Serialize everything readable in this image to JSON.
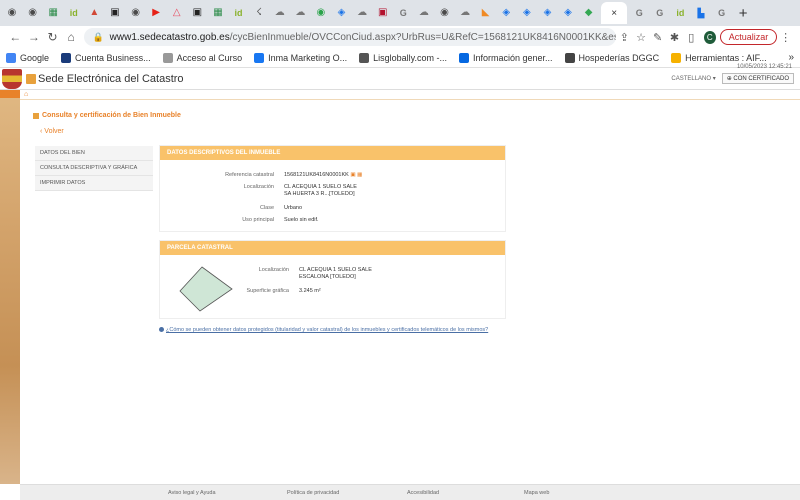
{
  "browser": {
    "tabs": [
      {
        "label": "",
        "color": "#4a4a4a",
        "glyph": "◉"
      },
      {
        "label": "",
        "color": "#4a4a4a",
        "glyph": "◉"
      },
      {
        "label": "",
        "color": "#2d8c4a",
        "glyph": "▦"
      },
      {
        "label": "id",
        "color": "#8ab22d",
        "glyph": ""
      },
      {
        "label": "",
        "color": "#d14836",
        "glyph": "▲"
      },
      {
        "label": "",
        "color": "#222222",
        "glyph": "▣"
      },
      {
        "label": "",
        "color": "#4a4a4a",
        "glyph": "◉"
      },
      {
        "label": "",
        "color": "#e62117",
        "glyph": "▶"
      },
      {
        "label": "",
        "color": "#e84a5f",
        "glyph": "△"
      },
      {
        "label": "",
        "color": "#222222",
        "glyph": "▣"
      },
      {
        "label": "",
        "color": "#2d8c4a",
        "glyph": "▦"
      },
      {
        "label": "id",
        "color": "#8ab22d",
        "glyph": ""
      },
      {
        "label": "",
        "color": "#555555",
        "glyph": "☇"
      },
      {
        "label": "",
        "color": "#777777",
        "glyph": "☁"
      },
      {
        "label": "",
        "color": "#777777",
        "glyph": "☁"
      },
      {
        "label": "",
        "color": "#2aa34a",
        "glyph": "◉"
      },
      {
        "label": "",
        "color": "#1a73e8",
        "glyph": "◈"
      },
      {
        "label": "",
        "color": "#777777",
        "glyph": "☁"
      },
      {
        "label": "",
        "color": "#b3122e",
        "glyph": "▣"
      },
      {
        "label": "G",
        "color": "#777777",
        "glyph": ""
      },
      {
        "label": "",
        "color": "#777777",
        "glyph": "☁"
      },
      {
        "label": "",
        "color": "#4a4a4a",
        "glyph": "◉"
      },
      {
        "label": "",
        "color": "#777777",
        "glyph": "☁"
      },
      {
        "label": "",
        "color": "#f08a24",
        "glyph": "◣"
      },
      {
        "label": "",
        "color": "#1a73e8",
        "glyph": "◈"
      },
      {
        "label": "",
        "color": "#1a73e8",
        "glyph": "◈"
      },
      {
        "label": "",
        "color": "#1a73e8",
        "glyph": "◈"
      },
      {
        "label": "",
        "color": "#1a73e8",
        "glyph": "◈"
      },
      {
        "label": "",
        "color": "#34a853",
        "glyph": "◆"
      }
    ],
    "active_tab_close": "×",
    "tabs_after": [
      {
        "label": "G",
        "color": "#777777"
      },
      {
        "label": "G",
        "color": "#777777"
      },
      {
        "label": "id",
        "color": "#8ab22d"
      },
      {
        "label": "▙",
        "color": "#1a73e8"
      },
      {
        "label": "G",
        "color": "#777777"
      }
    ],
    "new_tab": "+",
    "url_host": "www1.sedecatastro.gob.es",
    "url_rest": "/cycBienInmueble/OVCConCiud.aspx?UrbRus=U&RefC=1568121UK8416N0001KK&esBice...",
    "update_label": "Actualizar",
    "profile_initial": "C",
    "bookmarks": [
      {
        "label": "Google",
        "color": "#4285f4"
      },
      {
        "label": "Cuenta Business...",
        "color": "#1a3b7a"
      },
      {
        "label": "Acceso al Curso",
        "color": "#999999"
      },
      {
        "label": "Inma Marketing O...",
        "color": "#1877f2"
      },
      {
        "label": "Lisglobally.com -...",
        "color": "#555555"
      },
      {
        "label": "Información gener...",
        "color": "#0668e1"
      },
      {
        "label": "Hospederías DGGC",
        "color": "#444444"
      },
      {
        "label": "Herramientas : AIF...",
        "color": "#f6b100"
      }
    ],
    "bookmarks_more": "»"
  },
  "site": {
    "title": "Sede Electrónica del Catastro",
    "language": "CASTELLANO ▾",
    "login": "⊕ CON CERTIFICADO",
    "date": "10/05/2023 12:45:21",
    "home_icon": "⌂"
  },
  "page": {
    "heading": "Consulta y certificación de Bien Inmueble",
    "back": "Volver",
    "menu": [
      "Datos del bien",
      "Consulta descriptiva y gráfica",
      "Imprimir datos"
    ],
    "panel1": {
      "title": "DATOS DESCRIPTIVOS DEL INMUEBLE",
      "rows": [
        {
          "label": "Referencia catastral",
          "value": "1568121UK8416N0001KK"
        },
        {
          "label": "Localización",
          "value": "CL ACEQUIA 1 SUELO SALE\nSA HUERTA 3 R...[TOLEDO]"
        },
        {
          "label": "Clase",
          "value": "Urbano"
        },
        {
          "label": "Uso principal",
          "value": "Suelo sin edif."
        }
      ]
    },
    "panel2": {
      "title": "PARCELA CATASTRAL",
      "rows": [
        {
          "label": "Localización",
          "value": "CL ACEQUIA 1 SUELO SALE\nESCALONA [TOLEDO]"
        },
        {
          "label": "Superficie gráfica",
          "value": "3.245 m²"
        }
      ]
    },
    "info_link": "¿Cómo se pueden obtener datos protegidos (titularidad y valor catastral) de los inmuebles y certificados telemáticos de los mismos?"
  },
  "footer": {
    "links": [
      "Aviso legal y Ayuda",
      "Política de privacidad",
      "Accesibilidad",
      "Mapa web"
    ]
  }
}
